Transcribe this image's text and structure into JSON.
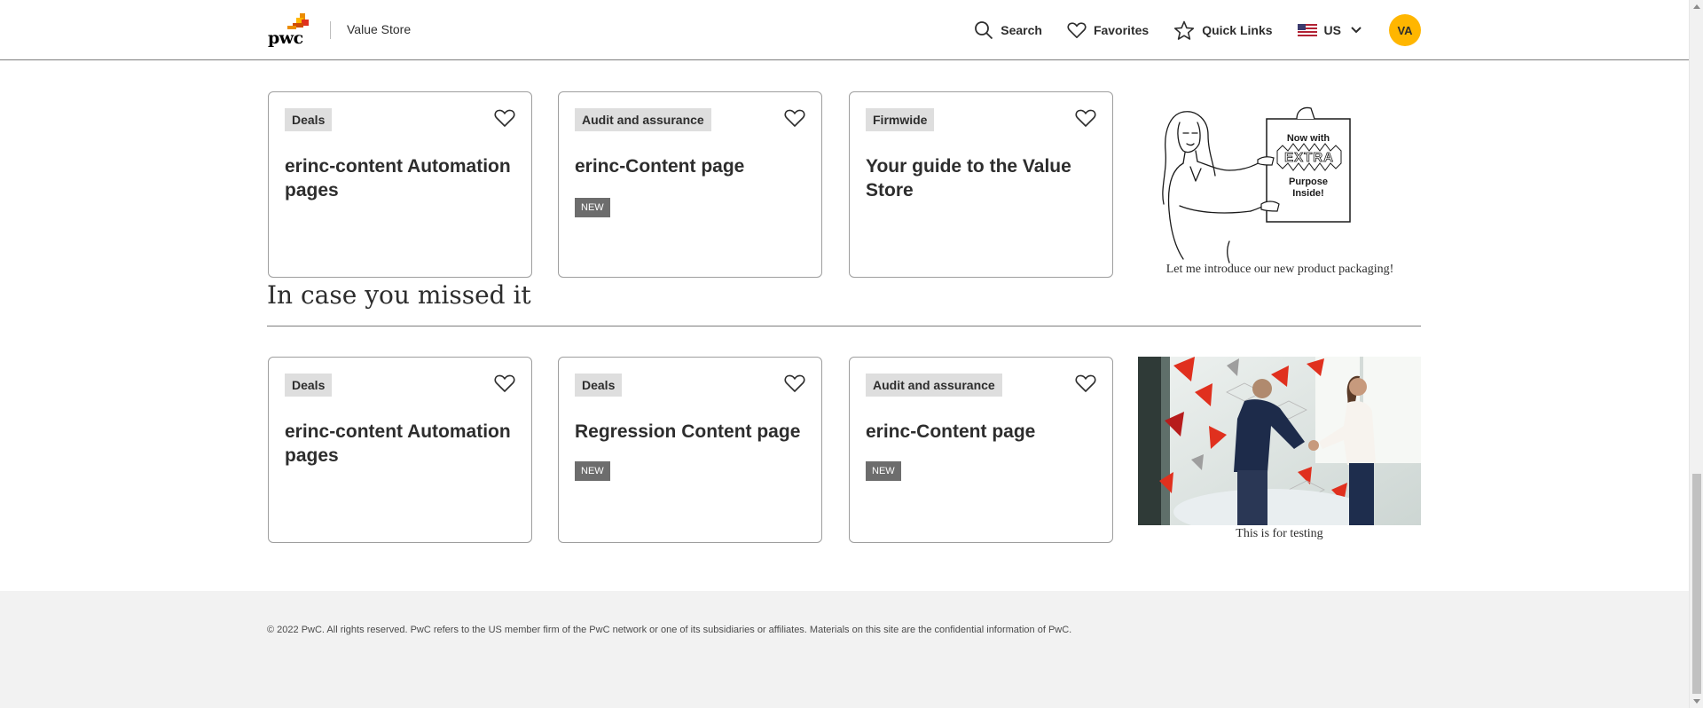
{
  "header": {
    "brand": "Value Store",
    "logo_text": "pwc",
    "nav": {
      "search": "Search",
      "favorites": "Favorites",
      "quick_links": "Quick Links",
      "locale": "US"
    },
    "avatar_initials": "VA"
  },
  "top_cards": [
    {
      "tag": "Deals",
      "title": "erinc-content Automation pages",
      "badge": ""
    },
    {
      "tag": "Audit and assurance",
      "title": "erinc-Content page",
      "badge": "NEW"
    },
    {
      "tag": "Firmwide",
      "title": "Your guide to the Value Store",
      "badge": ""
    }
  ],
  "top_promo": {
    "sign_lines": [
      "Now with",
      "EXTRA",
      "Purpose",
      "Inside!"
    ],
    "caption": "Let me introduce our new product packaging!"
  },
  "section": {
    "title": "In case you missed it"
  },
  "bottom_cards": [
    {
      "tag": "Deals",
      "title": "erinc-content Automation pages",
      "badge": ""
    },
    {
      "tag": "Deals",
      "title": "Regression Content page",
      "badge": "NEW"
    },
    {
      "tag": "Audit and assurance",
      "title": "erinc-Content page",
      "badge": "NEW"
    }
  ],
  "bottom_promo": {
    "caption": "This is for testing"
  },
  "footer": {
    "text": "© 2022 PwC. All rights reserved. PwC refers to the US member firm of the PwC network or one of its subsidiaries or affiliates. Materials on this site are the confidential information of PwC."
  },
  "colors": {
    "accent": "#ffb600",
    "brand_orange": "#eb8c00",
    "brand_red": "#e0301e",
    "tag_bg": "#dedede",
    "new_badge": "#6d6d6d"
  },
  "icons": [
    "search-icon",
    "heart-icon",
    "star-icon",
    "us-flag-icon",
    "chevron-down-icon"
  ]
}
